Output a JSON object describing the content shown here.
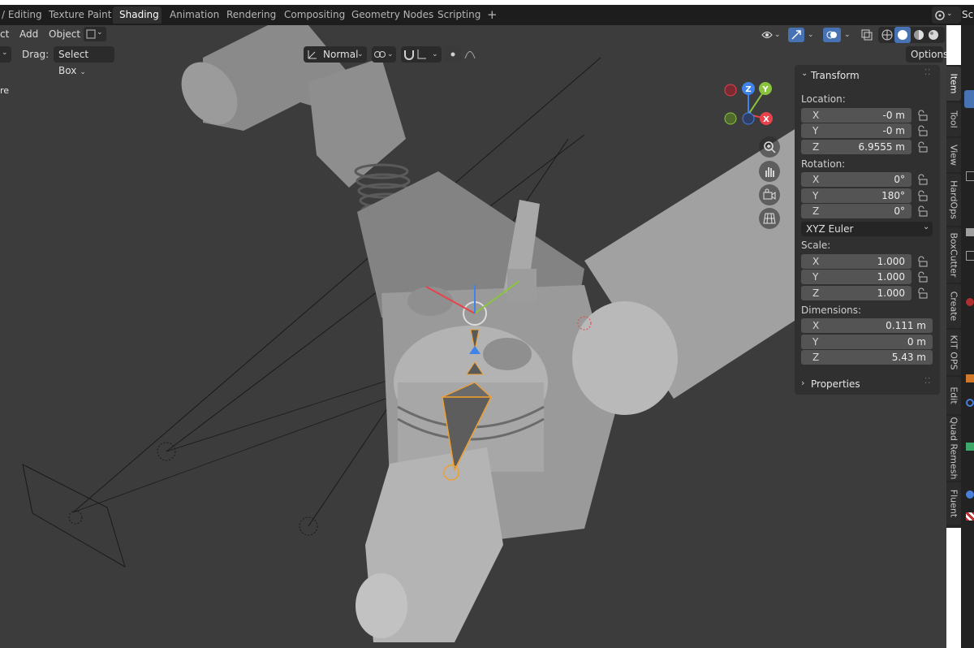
{
  "workspace_tabs": [
    {
      "label": "/ Editing"
    },
    {
      "label": "Texture Paint"
    },
    {
      "label": "Shading",
      "active": true
    },
    {
      "label": "Animation"
    },
    {
      "label": "Rendering"
    },
    {
      "label": "Compositing"
    },
    {
      "label": "Geometry Nodes"
    },
    {
      "label": "Scripting"
    }
  ],
  "add_workspace_icon": "plus-icon",
  "scene_label": "Sce",
  "header": {
    "menus": [
      "ct",
      "Add",
      "Object"
    ],
    "drag_label": "Drag:",
    "drag_value": "Select Box",
    "orientation_value": "Normal",
    "options_label": "Options"
  },
  "viewport": {
    "overlay_text": "re"
  },
  "npanel": {
    "section_title": "Transform",
    "location_label": "Location:",
    "location": [
      {
        "axis": "X",
        "value": "-0 m"
      },
      {
        "axis": "Y",
        "value": "-0 m"
      },
      {
        "axis": "Z",
        "value": "6.9555 m"
      }
    ],
    "rotation_label": "Rotation:",
    "rotation": [
      {
        "axis": "X",
        "value": "0°"
      },
      {
        "axis": "Y",
        "value": "180°"
      },
      {
        "axis": "Z",
        "value": "0°"
      }
    ],
    "rotation_mode": "XYZ Euler",
    "scale_label": "Scale:",
    "scale": [
      {
        "axis": "X",
        "value": "1.000"
      },
      {
        "axis": "Y",
        "value": "1.000"
      },
      {
        "axis": "Z",
        "value": "1.000"
      }
    ],
    "dimensions_label": "Dimensions:",
    "dimensions": [
      {
        "axis": "X",
        "value": "0.111 m"
      },
      {
        "axis": "Y",
        "value": "0 m"
      },
      {
        "axis": "Z",
        "value": "5.43 m"
      }
    ],
    "properties_title": "Properties"
  },
  "sidebar_tabs": [
    {
      "label": "Item",
      "active": true
    },
    {
      "label": "Tool"
    },
    {
      "label": "View"
    },
    {
      "label": "HardOps"
    },
    {
      "label": "BoxCutter"
    },
    {
      "label": "Create"
    },
    {
      "label": "KIT OPS"
    },
    {
      "label": "Edit"
    },
    {
      "label": "Quad Remesh"
    },
    {
      "label": "Fluent"
    }
  ],
  "gizmo": {
    "x": "X",
    "y": "Y",
    "z": "Z"
  },
  "colors": {
    "viewport_bg": "#3c3c3c",
    "panel_bg": "#303030",
    "field_bg": "#545454",
    "accent_blue": "#4772b3",
    "axis_x": "#e8424c",
    "axis_y": "#8bc43f",
    "axis_z": "#3f82e8",
    "selection_orange": "#f0a030"
  }
}
